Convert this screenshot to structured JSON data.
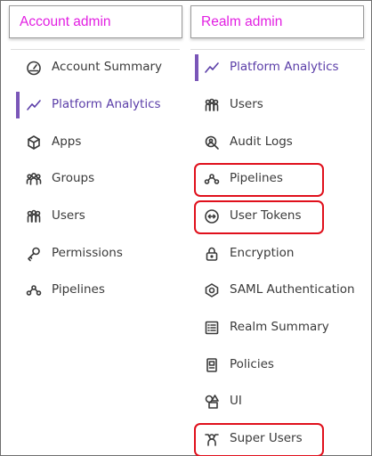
{
  "account": {
    "header": "Account admin",
    "items": [
      {
        "label": "Account Summary",
        "icon": "gauge-icon"
      },
      {
        "label": "Platform Analytics",
        "icon": "trend-line-icon",
        "active": true
      },
      {
        "label": "Apps",
        "icon": "cube-icon"
      },
      {
        "label": "Groups",
        "icon": "groups-icon"
      },
      {
        "label": "Users",
        "icon": "users-icon"
      },
      {
        "label": "Permissions",
        "icon": "key-icon"
      },
      {
        "label": "Pipelines",
        "icon": "pipelines-icon"
      }
    ]
  },
  "realm": {
    "header": "Realm admin",
    "items": [
      {
        "label": "Platform Analytics",
        "icon": "trend-line-icon",
        "active": true
      },
      {
        "label": "Users",
        "icon": "users-icon"
      },
      {
        "label": "Audit Logs",
        "icon": "audit-search-icon"
      },
      {
        "label": "Pipelines",
        "icon": "pipelines-icon",
        "highlighted": true
      },
      {
        "label": "User Tokens",
        "icon": "token-icon",
        "highlighted": true
      },
      {
        "label": "Encryption",
        "icon": "lock-icon"
      },
      {
        "label": "SAML Authentication",
        "icon": "saml-icon"
      },
      {
        "label": "Realm Summary",
        "icon": "list-icon"
      },
      {
        "label": "Policies",
        "icon": "policy-icon"
      },
      {
        "label": "UI",
        "icon": "ui-shapes-icon"
      },
      {
        "label": "Super Users",
        "icon": "super-user-icon",
        "highlighted": true
      }
    ]
  },
  "colors": {
    "header_text": "#e21fe2",
    "active_text": "#5b3ea8",
    "active_bar": "#7a56b8",
    "highlight_border": "#e0101c"
  }
}
